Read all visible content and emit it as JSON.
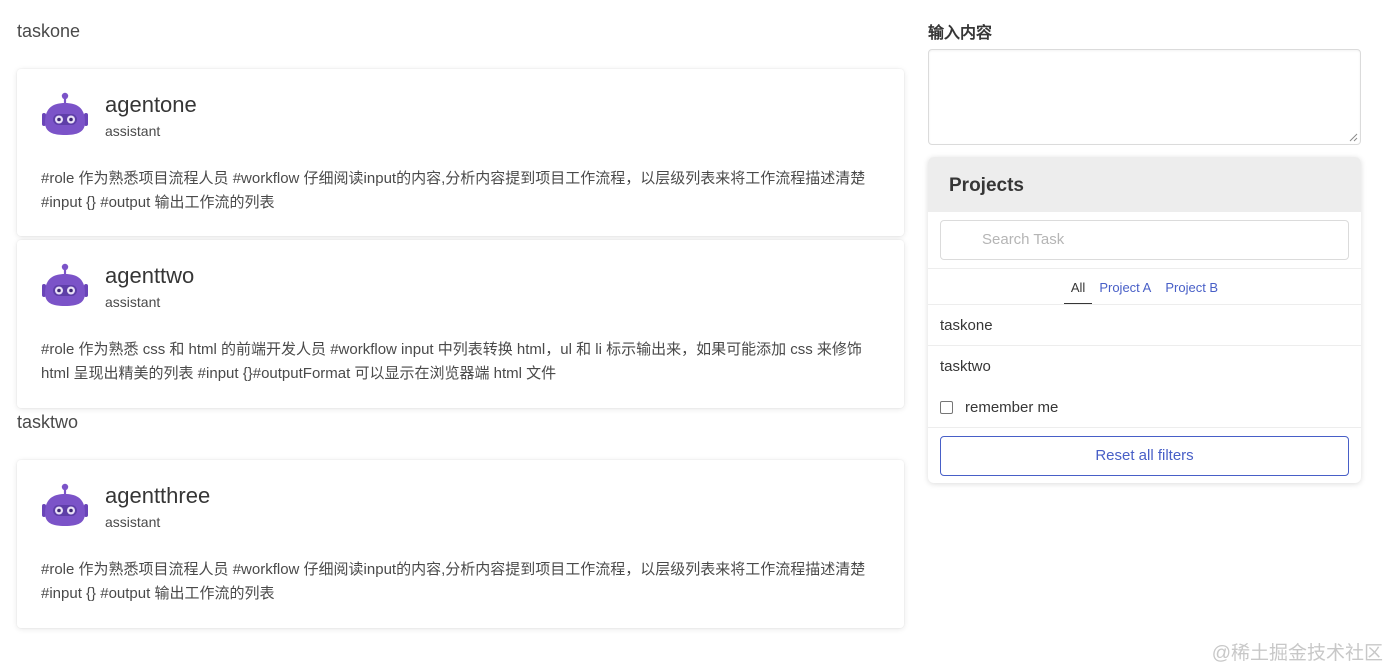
{
  "tasks": [
    {
      "title": "taskone",
      "agents": [
        {
          "name": "agentone",
          "role": "assistant",
          "prompt": "#role 作为熟悉项目流程人员 #workflow 仔细阅读input的内容,分析内容提到项目工作流程，以层级列表来将工作流程描述清楚 #input {} #output 输出工作流的列表"
        },
        {
          "name": "agenttwo",
          "role": "assistant",
          "prompt": "#role 作为熟悉 css 和 html 的前端开发人员 #workflow input 中列表转换 html，ul 和 li 标示输出来，如果可能添加 css 来修饰 html 呈现出精美的列表 #input {}#outputFormat 可以显示在浏览器端 html 文件"
        }
      ]
    },
    {
      "title": "tasktwo",
      "agents": [
        {
          "name": "agentthree",
          "role": "assistant",
          "prompt": "#role 作为熟悉项目流程人员 #workflow 仔细阅读input的内容,分析内容提到项目工作流程，以层级列表来将工作流程描述清楚 #input {} #output 输出工作流的列表"
        }
      ]
    }
  ],
  "sidebar": {
    "input_label": "输入内容",
    "textarea_value": "",
    "panel_title": "Projects",
    "search_placeholder": "Search Task",
    "tabs": [
      "All",
      "Project A",
      "Project B"
    ],
    "active_tab": "All",
    "items": [
      "taskone",
      "tasktwo"
    ],
    "remember_label": "remember me",
    "remember_checked": false,
    "reset_label": "Reset all filters"
  },
  "watermark": "@稀土掘金技术社区",
  "colors": {
    "link": "#485fc7",
    "avatar": "#7b53c8",
    "panel_heading_bg": "#ededed"
  },
  "icons": {
    "avatar": "robot-icon",
    "search": "search-icon"
  }
}
